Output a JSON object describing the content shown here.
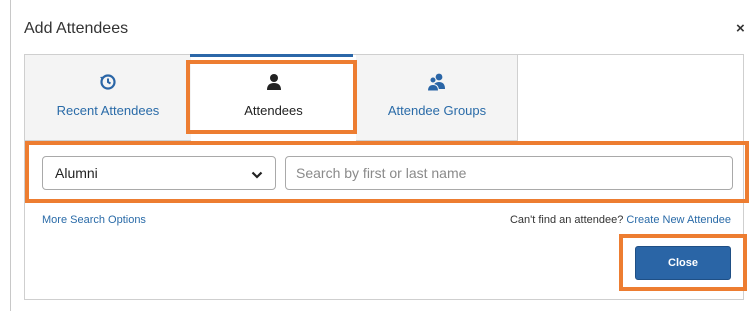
{
  "dialog": {
    "title": "Add Attendees",
    "close_glyph": "×"
  },
  "tabs": [
    {
      "label": "Recent Attendees",
      "icon": "history-icon",
      "active": false
    },
    {
      "label": "Attendees",
      "icon": "person-icon",
      "active": true
    },
    {
      "label": "Attendee Groups",
      "icon": "people-group-icon",
      "active": false
    }
  ],
  "search": {
    "filter_value": "Alumni",
    "placeholder": "Search by first or last name",
    "value": ""
  },
  "links": {
    "more_options": "More Search Options",
    "cant_find": "Can't find an attendee?",
    "create_new": "Create New Attendee"
  },
  "buttons": {
    "close_label": "Close"
  },
  "colors": {
    "accent": "#2a65a6",
    "link": "#2a6ba8",
    "highlight": "#ed7d31"
  }
}
